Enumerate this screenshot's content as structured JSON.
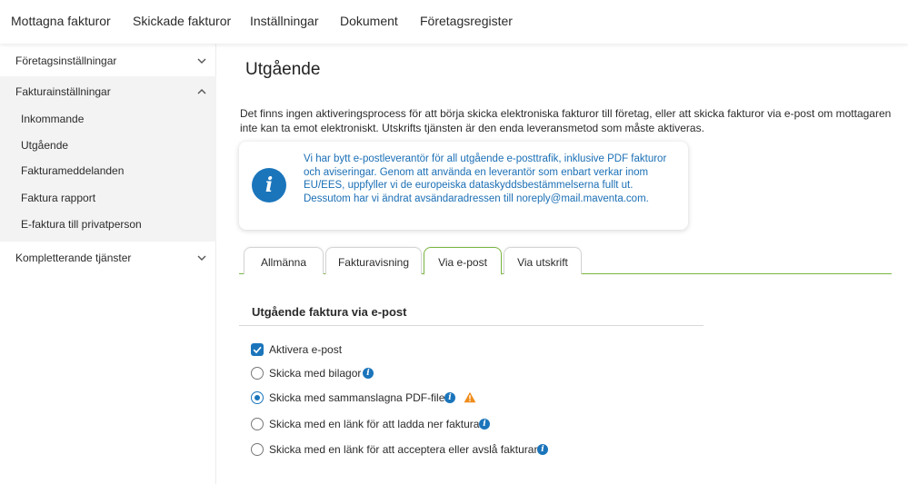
{
  "topnav": {
    "items": [
      "Mottagna fakturor",
      "Skickade fakturor",
      "Inställningar",
      "Dokument",
      "Företagsregister"
    ]
  },
  "sidebar": {
    "company_settings": "Företagsinställningar",
    "invoice_settings": "Fakturainställningar",
    "sub_items": [
      "Inkommande",
      "Utgående",
      "Fakturameddelanden",
      "Faktura rapport",
      "E-faktura till privatperson"
    ],
    "additional_services": "Kompletterande tjänster"
  },
  "main": {
    "title": "Utgående",
    "intro": "Det finns ingen aktiveringsprocess för att börja skicka elektroniska fakturor till företag, eller att skicka fakturor via e-post om mottagaren inte kan ta emot elektroniskt. Utskrifts tjänsten är den enda leveransmetod som måste aktiveras.",
    "info_box": {
      "icon": "info-icon",
      "line1": "Vi har bytt e-postleverantör för all utgående e-posttrafik, inklusive PDF fakturor och aviseringar. Genom att använda en leverantör som enbart verkar inom EU/EES, uppfyller vi de europeiska dataskyddsbestämmelserna fullt ut.",
      "line2": "Dessutom har vi ändrat avsändaradressen till noreply@mail.maventa.com."
    },
    "tabs": [
      "Allmänna",
      "Fakturavisning",
      "Via e-post",
      "Via utskrift"
    ],
    "active_tab": "Via e-post",
    "section_title": "Utgående faktura via e-post",
    "options": {
      "activate_email": {
        "label": "Aktivera e-post",
        "checked": true
      },
      "with_attachments": {
        "label": "Skicka med bilagor",
        "selected": false
      },
      "merged_pdf": {
        "label": "Skicka med sammanslagna PDF-filer",
        "selected": true
      },
      "download_link": {
        "label": "Skicka med en länk för att ladda ner faktura",
        "selected": false
      },
      "accept_link": {
        "label": "Skicka med en länk för att acceptera eller avslå fakturan",
        "selected": false
      }
    }
  },
  "colors": {
    "accent_blue": "#1b75bb",
    "tab_green": "#7ab641",
    "warning_orange": "#f08c1a",
    "sidebar_active_bg": "#f3f3f3"
  }
}
